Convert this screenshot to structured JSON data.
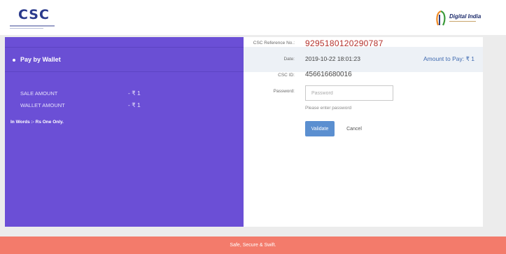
{
  "header": {
    "csc_logo_text": "CSC",
    "digital_india_text": "Digital India"
  },
  "payment": {
    "method_label": "Pay by Wallet",
    "amount_to_pay_label": "Amount to Pay:",
    "amount_to_pay_value": "₹ 1"
  },
  "summary": {
    "sale_amount_label": "SALE AMOUNT",
    "sale_amount_value": "- ₹ 1",
    "wallet_amount_label": "WALLET AMOUNT",
    "wallet_amount_value": "- ₹ 1",
    "in_words": "In Words :- Rs One Only."
  },
  "details": {
    "reference_label": "CSC Reference No.:",
    "reference_value": "9295180120290787",
    "date_label": "Date:",
    "date_value": "2019-10-22 18:01:23",
    "csc_id_label": "CSC ID:",
    "csc_id_value": "456616680016",
    "password_label": "Password:",
    "password_placeholder": "Password",
    "password_value": "",
    "password_hint": "Please enter password"
  },
  "actions": {
    "validate_label": "Validate",
    "cancel_label": "Cancel"
  },
  "footer": {
    "text": "Safe, Secure & Swift."
  },
  "colors": {
    "left_panel": "#6b4fd6",
    "reference_red": "#b5322c",
    "validate_blue": "#5b8fd0",
    "footer_coral": "#f37b6b"
  }
}
